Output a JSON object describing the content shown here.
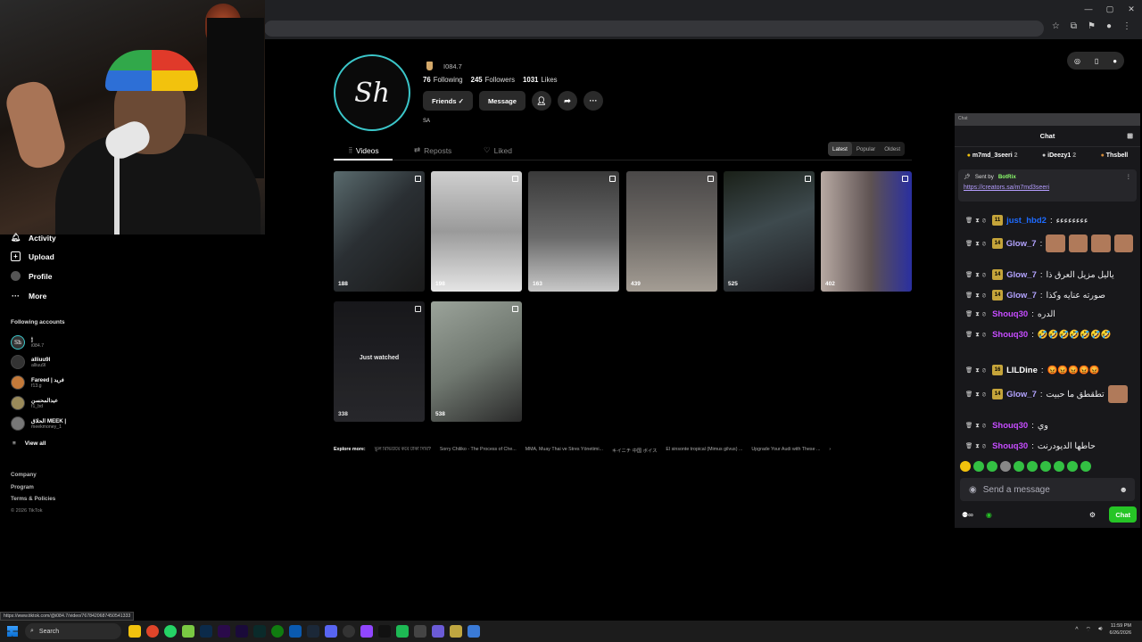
{
  "profile": {
    "username": "I084.7",
    "avatar_text": "Sh",
    "following_count": "76",
    "following_label": "Following",
    "followers_count": "245",
    "followers_label": "Followers",
    "likes_count": "1031",
    "likes_label": "Likes",
    "friends_button": "Friends ✓",
    "message_button": "Message",
    "bio": "SA"
  },
  "sidebar": {
    "items": [
      {
        "label": "Activity",
        "icon": "bell-icon"
      },
      {
        "label": "Upload",
        "icon": "plus-icon"
      },
      {
        "label": "Profile",
        "icon": "profile-icon"
      },
      {
        "label": "More",
        "icon": "more-icon"
      }
    ],
    "following_title": "Following accounts",
    "accounts": [
      {
        "name": "🕯",
        "handle": "i084.7"
      },
      {
        "name": "alliuu9l",
        "handle": "alliuu9l"
      },
      {
        "name": "Fareed | فريد",
        "handle": "f13.g"
      },
      {
        "name": "عبدالمحسن",
        "handle": "f1_bd"
      },
      {
        "name": "الحلاق MEEK |",
        "handle": "meekmoney_1"
      }
    ],
    "view_all": "View all",
    "footer": [
      "Company",
      "Program",
      "Terms & Policies"
    ],
    "copyright": "© 2026 TikTok"
  },
  "tabs": [
    {
      "label": "Videos",
      "icon": "grid-icon"
    },
    {
      "label": "Reposts",
      "icon": "repost-icon"
    },
    {
      "label": "Liked",
      "icon": "heart-icon"
    }
  ],
  "sort_options": [
    "Latest",
    "Popular",
    "Oldest"
  ],
  "videos": [
    {
      "views": "188",
      "bg": "linear-gradient(135deg,#5a6b6e 0%,#2a2f33 45%,#1a1a1a 100%)"
    },
    {
      "views": "198",
      "bg": "linear-gradient(180deg,#cfcfcf 0%,#9a9a9a 50%,#e5e5e5 100%)"
    },
    {
      "views": "163",
      "bg": "linear-gradient(180deg,#3a3a3a 0%,#6a6a6a 55%,#c8c8c8 100%)"
    },
    {
      "views": "439",
      "bg": "linear-gradient(180deg,#4a4848 0%,#6e6a66 50%,#a49d94 100%)"
    },
    {
      "views": "525",
      "bg": "linear-gradient(160deg,#1a2018 0%,#3e4a4e 45%,#1e1e22 100%)"
    },
    {
      "views": "402",
      "bg": "linear-gradient(90deg,#b7a9a2 0%,#5e5252 55%,#2a2fa0 100%)"
    },
    {
      "views": "338",
      "bg": "linear-gradient(180deg,#1a1a1e 0%,#2c2c30 100%)",
      "overlay": "Just watched"
    },
    {
      "views": "538",
      "bg": "linear-gradient(150deg,#9ba39a 0%,#707870 50%,#2a2a2a 100%)"
    }
  ],
  "explore": {
    "label": "Explore more:",
    "items": [
      "ভুল রিভিউয়ে কবে টাকা দিবি?",
      "Sorry Chiliko - The Process of Che...",
      "MMA, Muay Thai ve Stres Yönetimi...",
      "キイニチ 中国 ボイス",
      "El sinsonte tropical (Mimus gilvus) ...",
      "Upgrade Your Audi with These ..."
    ]
  },
  "chat": {
    "title": "Chat",
    "gifters": [
      {
        "name": "m7md_3seeri",
        "count": "2"
      },
      {
        "name": "iDeezy1",
        "count": "2"
      },
      {
        "name": "Thsbell",
        "count": ""
      }
    ],
    "pinned_by_label": "Sent by",
    "pinned_by": "BotRix",
    "pinned_link": "https://creators.sa/m7md3seeri",
    "messages": [
      {
        "level": "11",
        "user": "just_hbd2",
        "color": "#1e6bff",
        "text": "ءءءءءءءء",
        "emotes": 0
      },
      {
        "level": "14",
        "user": "Glow_7",
        "color": "#b3a3ff",
        "text": "",
        "emotes": 4
      },
      {
        "level": "14",
        "user": "Glow_7",
        "color": "#b3a3ff",
        "text": "ياليل مزيل العرق ذا",
        "emotes": 0
      },
      {
        "level": "14",
        "user": "Glow_7",
        "color": "#b3a3ff",
        "text": "صورته عنايه وكذا",
        "emotes": 0
      },
      {
        "level": "",
        "user": "Shouq30",
        "color": "#c64dff",
        "text": "الدره",
        "emotes": 0
      },
      {
        "level": "",
        "user": "Shouq30",
        "color": "#c64dff",
        "text": "🤣🤣🤣🤣🤣🤣🤣",
        "emotes": 0
      },
      {
        "level": "16",
        "user": "LILDine",
        "color": "#ffffff",
        "text": "😡😡😡😡😡",
        "emotes": 0
      },
      {
        "level": "14",
        "user": "Glow_7",
        "color": "#b3a3ff",
        "text": "تطقطق ما حبيت",
        "emotes": 1
      },
      {
        "level": "",
        "user": "Shouq30",
        "color": "#c64dff",
        "text": "وي",
        "emotes": 0
      },
      {
        "level": "",
        "user": "Shouq30",
        "color": "#c64dff",
        "text": "حاطها الديودرنت",
        "emotes": 0
      }
    ],
    "input_placeholder": "Send a message",
    "chat_button": "Chat",
    "accent": "#26c526"
  },
  "status_url": "https://www.tiktok.com/@i084.7/video/7678420687450541333",
  "taskbar": {
    "search_label": "Search",
    "time": "11:59 PM",
    "date": "6/26/2026"
  }
}
